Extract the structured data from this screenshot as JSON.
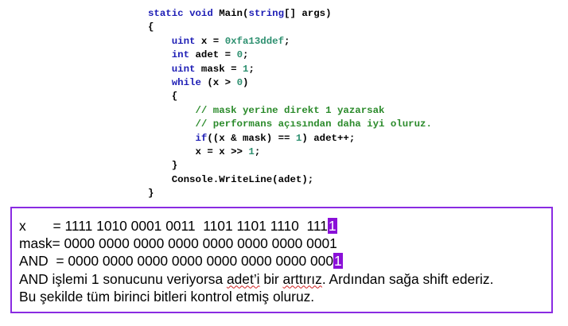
{
  "code": {
    "l1_kw1": "static",
    "l1_sp1": " ",
    "l1_kw2": "void",
    "l1_t1": " Main(",
    "l1_kw3": "string",
    "l1_t2": "[] args)",
    "l2": "{",
    "l3_ind": "    ",
    "l3_kw": "uint",
    "l3_t1": " x = ",
    "l3_num": "0xfa13ddef",
    "l3_t2": ";",
    "l4_ind": "    ",
    "l4_kw": "int",
    "l4_t1": " adet = ",
    "l4_num": "0",
    "l4_t2": ";",
    "l5_ind": "    ",
    "l5_kw": "uint",
    "l5_t1": " mask = ",
    "l5_num": "1",
    "l5_t2": ";",
    "l6_ind": "    ",
    "l6_kw": "while",
    "l6_t1": " (x > ",
    "l6_num": "0",
    "l6_t2": ")",
    "l7": "    {",
    "l8_ind": "        ",
    "l8": "// mask yerine direkt 1 yazarsak",
    "l9_ind": "        ",
    "l9": "// performans açısından daha iyi oluruz.",
    "l10_ind": "        ",
    "l10_kw": "if",
    "l10_t1": "((x & mask) == ",
    "l10_num": "1",
    "l10_t2": ") adet++;",
    "l11_ind": "        ",
    "l11_t1": "x = x >> ",
    "l11_num": "1",
    "l11_t2": ";",
    "l12": "    }",
    "l13": "    Console.WriteLine(adet);",
    "l14": "}"
  },
  "explanation": {
    "line1_prefix": "x       = 1111 1010 0001 0011  1101 1101 1110  111",
    "line1_hl": "1",
    "line2": "mask= 0000 0000 0000 0000 0000 0000 0000 0001",
    "line3_prefix": "AND  = 0000 0000 0000 0000 0000 0000 0000 000",
    "line3_hl": "1",
    "line4_a": "AND işlemi 1 sonucunu veriyorsa ",
    "line4_squig": "adet’i",
    "line4_b": " bir ",
    "line4_squig2": "arttırız",
    "line4_c": ". Ardından sağa shift ederiz.",
    "line5": "Bu şekilde tüm birinci bitleri kontrol etmiş oluruz."
  },
  "colors": {
    "keyword": "#1d1db5",
    "number": "#2e9070",
    "comment": "#2a8a2a",
    "box_border": "#8a2be2",
    "highlight": "#8a10d8"
  }
}
